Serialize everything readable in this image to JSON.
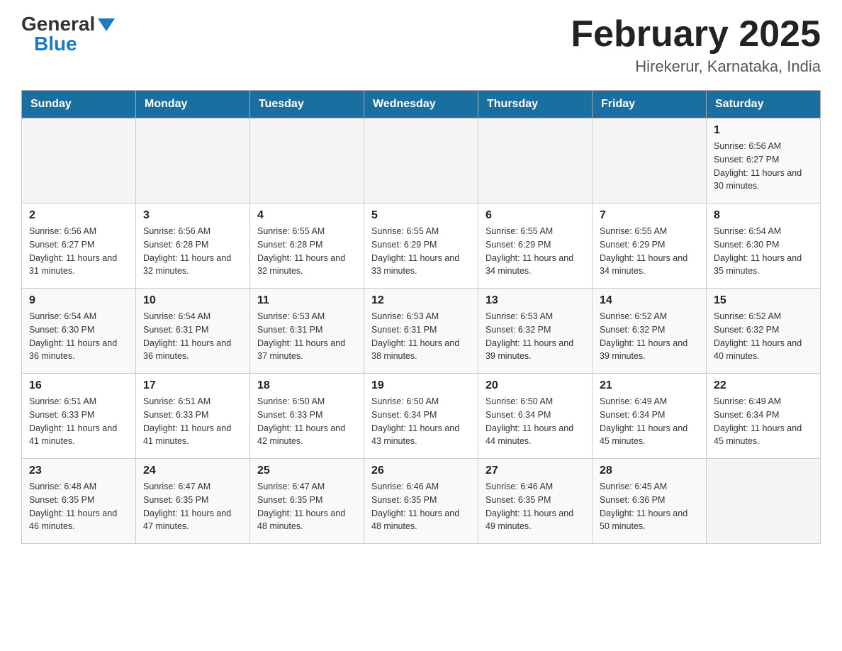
{
  "header": {
    "logo_general": "General",
    "logo_blue": "Blue",
    "month_title": "February 2025",
    "location": "Hirekerur, Karnataka, India"
  },
  "weekdays": [
    "Sunday",
    "Monday",
    "Tuesday",
    "Wednesday",
    "Thursday",
    "Friday",
    "Saturday"
  ],
  "weeks": [
    {
      "days": [
        {
          "number": "",
          "sunrise": "",
          "sunset": "",
          "daylight": ""
        },
        {
          "number": "",
          "sunrise": "",
          "sunset": "",
          "daylight": ""
        },
        {
          "number": "",
          "sunrise": "",
          "sunset": "",
          "daylight": ""
        },
        {
          "number": "",
          "sunrise": "",
          "sunset": "",
          "daylight": ""
        },
        {
          "number": "",
          "sunrise": "",
          "sunset": "",
          "daylight": ""
        },
        {
          "number": "",
          "sunrise": "",
          "sunset": "",
          "daylight": ""
        },
        {
          "number": "1",
          "sunrise": "Sunrise: 6:56 AM",
          "sunset": "Sunset: 6:27 PM",
          "daylight": "Daylight: 11 hours and 30 minutes."
        }
      ]
    },
    {
      "days": [
        {
          "number": "2",
          "sunrise": "Sunrise: 6:56 AM",
          "sunset": "Sunset: 6:27 PM",
          "daylight": "Daylight: 11 hours and 31 minutes."
        },
        {
          "number": "3",
          "sunrise": "Sunrise: 6:56 AM",
          "sunset": "Sunset: 6:28 PM",
          "daylight": "Daylight: 11 hours and 32 minutes."
        },
        {
          "number": "4",
          "sunrise": "Sunrise: 6:55 AM",
          "sunset": "Sunset: 6:28 PM",
          "daylight": "Daylight: 11 hours and 32 minutes."
        },
        {
          "number": "5",
          "sunrise": "Sunrise: 6:55 AM",
          "sunset": "Sunset: 6:29 PM",
          "daylight": "Daylight: 11 hours and 33 minutes."
        },
        {
          "number": "6",
          "sunrise": "Sunrise: 6:55 AM",
          "sunset": "Sunset: 6:29 PM",
          "daylight": "Daylight: 11 hours and 34 minutes."
        },
        {
          "number": "7",
          "sunrise": "Sunrise: 6:55 AM",
          "sunset": "Sunset: 6:29 PM",
          "daylight": "Daylight: 11 hours and 34 minutes."
        },
        {
          "number": "8",
          "sunrise": "Sunrise: 6:54 AM",
          "sunset": "Sunset: 6:30 PM",
          "daylight": "Daylight: 11 hours and 35 minutes."
        }
      ]
    },
    {
      "days": [
        {
          "number": "9",
          "sunrise": "Sunrise: 6:54 AM",
          "sunset": "Sunset: 6:30 PM",
          "daylight": "Daylight: 11 hours and 36 minutes."
        },
        {
          "number": "10",
          "sunrise": "Sunrise: 6:54 AM",
          "sunset": "Sunset: 6:31 PM",
          "daylight": "Daylight: 11 hours and 36 minutes."
        },
        {
          "number": "11",
          "sunrise": "Sunrise: 6:53 AM",
          "sunset": "Sunset: 6:31 PM",
          "daylight": "Daylight: 11 hours and 37 minutes."
        },
        {
          "number": "12",
          "sunrise": "Sunrise: 6:53 AM",
          "sunset": "Sunset: 6:31 PM",
          "daylight": "Daylight: 11 hours and 38 minutes."
        },
        {
          "number": "13",
          "sunrise": "Sunrise: 6:53 AM",
          "sunset": "Sunset: 6:32 PM",
          "daylight": "Daylight: 11 hours and 39 minutes."
        },
        {
          "number": "14",
          "sunrise": "Sunrise: 6:52 AM",
          "sunset": "Sunset: 6:32 PM",
          "daylight": "Daylight: 11 hours and 39 minutes."
        },
        {
          "number": "15",
          "sunrise": "Sunrise: 6:52 AM",
          "sunset": "Sunset: 6:32 PM",
          "daylight": "Daylight: 11 hours and 40 minutes."
        }
      ]
    },
    {
      "days": [
        {
          "number": "16",
          "sunrise": "Sunrise: 6:51 AM",
          "sunset": "Sunset: 6:33 PM",
          "daylight": "Daylight: 11 hours and 41 minutes."
        },
        {
          "number": "17",
          "sunrise": "Sunrise: 6:51 AM",
          "sunset": "Sunset: 6:33 PM",
          "daylight": "Daylight: 11 hours and 41 minutes."
        },
        {
          "number": "18",
          "sunrise": "Sunrise: 6:50 AM",
          "sunset": "Sunset: 6:33 PM",
          "daylight": "Daylight: 11 hours and 42 minutes."
        },
        {
          "number": "19",
          "sunrise": "Sunrise: 6:50 AM",
          "sunset": "Sunset: 6:34 PM",
          "daylight": "Daylight: 11 hours and 43 minutes."
        },
        {
          "number": "20",
          "sunrise": "Sunrise: 6:50 AM",
          "sunset": "Sunset: 6:34 PM",
          "daylight": "Daylight: 11 hours and 44 minutes."
        },
        {
          "number": "21",
          "sunrise": "Sunrise: 6:49 AM",
          "sunset": "Sunset: 6:34 PM",
          "daylight": "Daylight: 11 hours and 45 minutes."
        },
        {
          "number": "22",
          "sunrise": "Sunrise: 6:49 AM",
          "sunset": "Sunset: 6:34 PM",
          "daylight": "Daylight: 11 hours and 45 minutes."
        }
      ]
    },
    {
      "days": [
        {
          "number": "23",
          "sunrise": "Sunrise: 6:48 AM",
          "sunset": "Sunset: 6:35 PM",
          "daylight": "Daylight: 11 hours and 46 minutes."
        },
        {
          "number": "24",
          "sunrise": "Sunrise: 6:47 AM",
          "sunset": "Sunset: 6:35 PM",
          "daylight": "Daylight: 11 hours and 47 minutes."
        },
        {
          "number": "25",
          "sunrise": "Sunrise: 6:47 AM",
          "sunset": "Sunset: 6:35 PM",
          "daylight": "Daylight: 11 hours and 48 minutes."
        },
        {
          "number": "26",
          "sunrise": "Sunrise: 6:46 AM",
          "sunset": "Sunset: 6:35 PM",
          "daylight": "Daylight: 11 hours and 48 minutes."
        },
        {
          "number": "27",
          "sunrise": "Sunrise: 6:46 AM",
          "sunset": "Sunset: 6:35 PM",
          "daylight": "Daylight: 11 hours and 49 minutes."
        },
        {
          "number": "28",
          "sunrise": "Sunrise: 6:45 AM",
          "sunset": "Sunset: 6:36 PM",
          "daylight": "Daylight: 11 hours and 50 minutes."
        },
        {
          "number": "",
          "sunrise": "",
          "sunset": "",
          "daylight": ""
        }
      ]
    }
  ]
}
